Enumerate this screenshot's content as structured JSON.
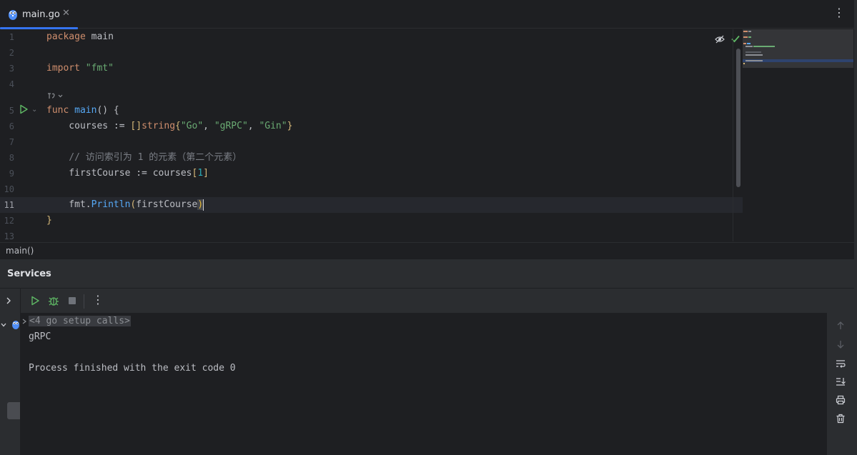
{
  "tab": {
    "label": "main.go",
    "close": "✕"
  },
  "editor": {
    "lines": [
      {
        "n": "1"
      },
      {
        "n": "2"
      },
      {
        "n": "3"
      },
      {
        "n": "4"
      },
      {
        "n": "5"
      },
      {
        "n": "6"
      },
      {
        "n": "7"
      },
      {
        "n": "8"
      },
      {
        "n": "9"
      },
      {
        "n": "10"
      },
      {
        "n": "11"
      },
      {
        "n": "12"
      },
      {
        "n": "13"
      }
    ],
    "code": {
      "l1_kw": "package",
      "l1_rest": " main",
      "l3_kw": "import",
      "l3_str": " \"fmt\"",
      "l5_kw": "func",
      "l5_fn": " main",
      "l5_rest": "() {",
      "l6_a": "    courses := ",
      "l6_br1": "[]",
      "l6_type": "string",
      "l6_br2": "{",
      "l6_s1": "\"Go\"",
      "l6_c1": ", ",
      "l6_s2": "\"gRPC\"",
      "l6_c2": ", ",
      "l6_s3": "\"Gin\"",
      "l6_br3": "}",
      "l8_cmt": "    // 访问索引为 1 的元素（第二个元素）",
      "l9_a": "    firstCourse := courses",
      "l9_br1": "[",
      "l9_num": "1",
      "l9_br2": "]",
      "l11_a": "    fmt.",
      "l11_fn": "Println",
      "l11_br1": "(",
      "l11_arg": "firstCourse",
      "l11_br2": ")",
      "l12": "}"
    },
    "current_line": "11"
  },
  "breadcrumb": {
    "label": "main()"
  },
  "services": {
    "title": "Services",
    "console": {
      "fold": "<4 go setup calls>",
      "line2": "gRPC",
      "line4": "Process finished with the exit code 0"
    }
  },
  "colors": {
    "accent": "#3574f0",
    "keyword": "#cf8e6d",
    "function": "#56a8f5",
    "string": "#6aab73",
    "number": "#2aacb8",
    "comment": "#7a7e85"
  }
}
